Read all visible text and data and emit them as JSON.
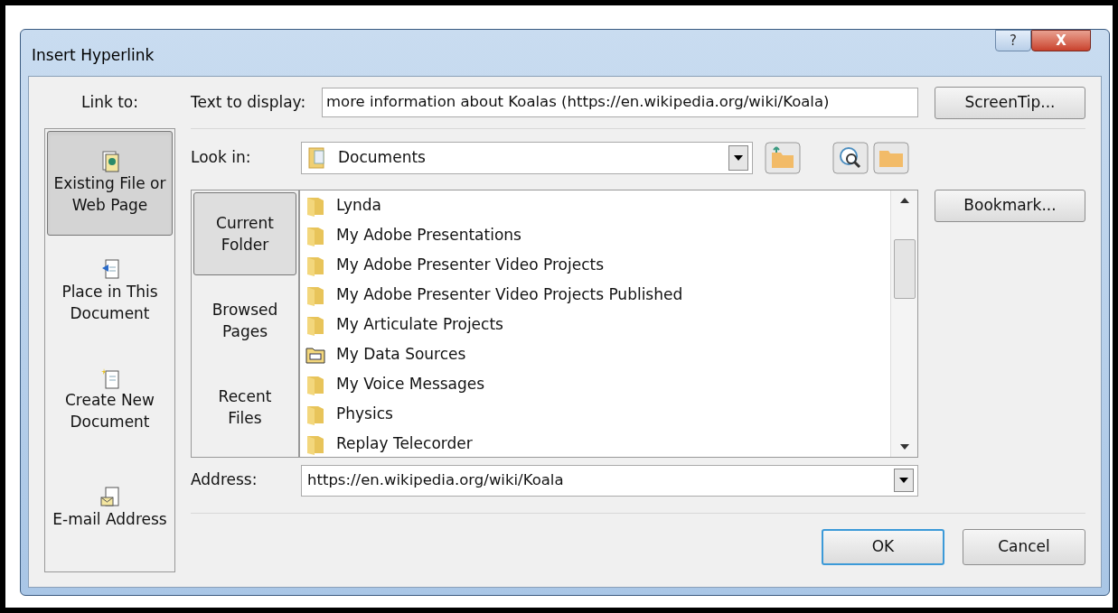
{
  "window": {
    "title": "Insert Hyperlink",
    "buttons": [
      {
        "kind": "help",
        "label": "?"
      },
      {
        "kind": "close",
        "label": "X"
      }
    ]
  },
  "link_to": {
    "label": "Link to:",
    "items": [
      {
        "label": "Existing File or Web Page",
        "kind": "file",
        "selected": true
      },
      {
        "label": "Place in This Document",
        "kind": "place",
        "selected": false
      },
      {
        "label": "Create New Document",
        "kind": "new",
        "selected": false
      },
      {
        "label": "E-mail Address",
        "kind": "email",
        "selected": false
      }
    ]
  },
  "text_to_display": {
    "label": "Text to display:",
    "value": "more information about Koalas (https://en.wikipedia.org/wiki/Koala)"
  },
  "screentip_button": "ScreenTip...",
  "look_in": {
    "label": "Look in:",
    "value": "Documents"
  },
  "view_tabs": [
    {
      "label": "Current Folder",
      "selected": true
    },
    {
      "label": "Browsed Pages",
      "selected": false
    },
    {
      "label": "Recent Files",
      "selected": false
    }
  ],
  "files": [
    {
      "name": "Lynda",
      "kind": "folder"
    },
    {
      "name": "My Adobe Presentations",
      "kind": "folder"
    },
    {
      "name": "My Adobe Presenter Video Projects",
      "kind": "folder"
    },
    {
      "name": "My Adobe Presenter Video Projects Published",
      "kind": "folder"
    },
    {
      "name": "My Articulate Projects",
      "kind": "folder"
    },
    {
      "name": "My Data Sources",
      "kind": "datasource"
    },
    {
      "name": "My Voice Messages",
      "kind": "folder"
    },
    {
      "name": "Physics",
      "kind": "folder"
    },
    {
      "name": "Replay Telecorder",
      "kind": "folder"
    }
  ],
  "bookmark_button": "Bookmark...",
  "address": {
    "label": "Address:",
    "value": "https://en.wikipedia.org/wiki/Koala"
  },
  "buttons": [
    "OK",
    "Cancel"
  ]
}
